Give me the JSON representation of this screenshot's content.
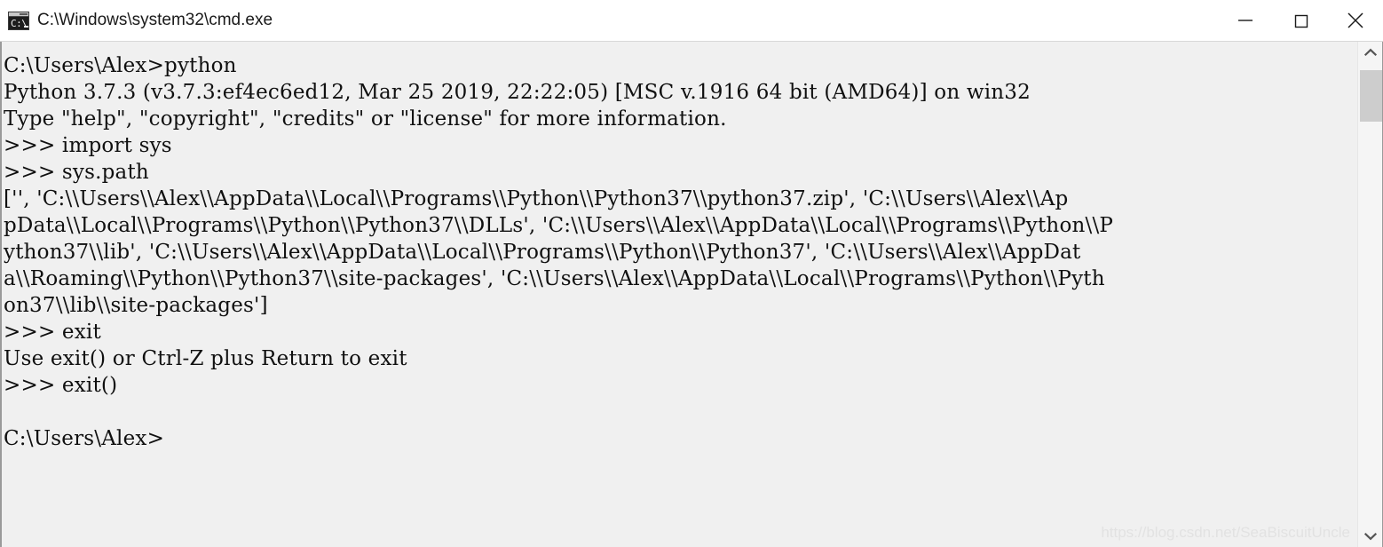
{
  "window": {
    "title": "C:\\Windows\\system32\\cmd.exe",
    "icon_name": "cmd-exe-icon",
    "icon_glyph": "C:\\",
    "background_color": "#f0f0f0",
    "text_color": "#101010",
    "titlebar_color": "#ffffff"
  },
  "window_controls": {
    "minimize_label": "Minimize",
    "maximize_label": "Maximize",
    "close_label": "Close"
  },
  "console": {
    "lines": [
      "C:\\Users\\Alex>python",
      "Python 3.7.3 (v3.7.3:ef4ec6ed12, Mar 25 2019, 22:22:05) [MSC v.1916 64 bit (AMD64)] on win32",
      "Type \"help\", \"copyright\", \"credits\" or \"license\" for more information.",
      ">>> import sys",
      ">>> sys.path",
      "['', 'C:\\\\Users\\\\Alex\\\\AppData\\\\Local\\\\Programs\\\\Python\\\\Python37\\\\python37.zip', 'C:\\\\Users\\\\Alex\\\\Ap",
      "pData\\\\Local\\\\Programs\\\\Python\\\\Python37\\\\DLLs', 'C:\\\\Users\\\\Alex\\\\AppData\\\\Local\\\\Programs\\\\Python\\\\P",
      "ython37\\\\lib', 'C:\\\\Users\\\\Alex\\\\AppData\\\\Local\\\\Programs\\\\Python\\\\Python37', 'C:\\\\Users\\\\Alex\\\\AppDat",
      "a\\\\Roaming\\\\Python\\\\Python37\\\\site-packages', 'C:\\\\Users\\\\Alex\\\\AppData\\\\Local\\\\Programs\\\\Python\\\\Pyth",
      "on37\\\\lib\\\\site-packages']",
      ">>> exit",
      "Use exit() or Ctrl-Z plus Return to exit",
      ">>> exit()",
      "",
      "C:\\Users\\Alex>"
    ],
    "text": "C:\\Users\\Alex>python\nPython 3.7.3 (v3.7.3:ef4ec6ed12, Mar 25 2019, 22:22:05) [MSC v.1916 64 bit (AMD64)] on win32\nType \"help\", \"copyright\", \"credits\" or \"license\" for more information.\n>>> import sys\n>>> sys.path\n['', 'C:\\\\Users\\\\Alex\\\\AppData\\\\Local\\\\Programs\\\\Python\\\\Python37\\\\python37.zip', 'C:\\\\Users\\\\Alex\\\\Ap\npData\\\\Local\\\\Programs\\\\Python\\\\Python37\\\\DLLs', 'C:\\\\Users\\\\Alex\\\\AppData\\\\Local\\\\Programs\\\\Python\\\\P\nython37\\\\lib', 'C:\\\\Users\\\\Alex\\\\AppData\\\\Local\\\\Programs\\\\Python\\\\Python37', 'C:\\\\Users\\\\Alex\\\\AppDat\na\\\\Roaming\\\\Python\\\\Python37\\\\site-packages', 'C:\\\\Users\\\\Alex\\\\AppData\\\\Local\\\\Programs\\\\Python\\\\Pyth\non37\\\\lib\\\\site-packages']\n>>> exit\nUse exit() or Ctrl-Z plus Return to exit\n>>> exit()\n\nC:\\Users\\Alex>"
  },
  "watermark": {
    "text": "https://blog.csdn.net/SeaBiscuitUncle"
  },
  "scrollbar": {
    "up_arrow_label": "Scroll up",
    "down_arrow_label": "Scroll down",
    "thumb_label": "Scroll thumb"
  }
}
